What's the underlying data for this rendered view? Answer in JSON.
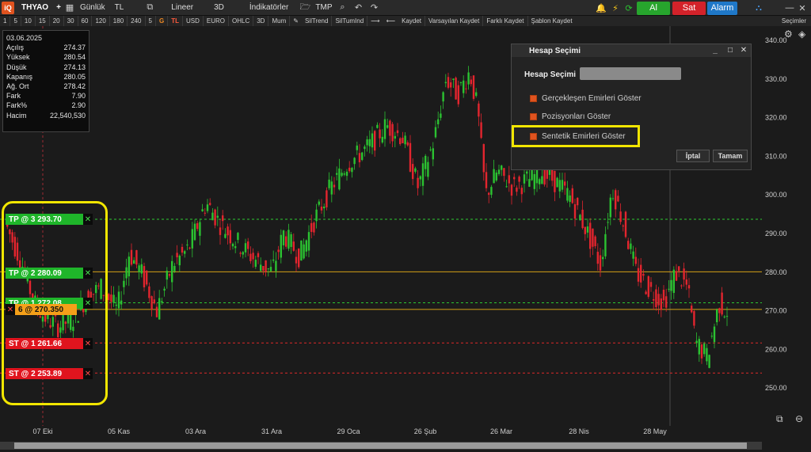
{
  "toolbar": {
    "logo": "iQ",
    "symbol": "THYAO",
    "plus": "+",
    "period": "Günlük",
    "currency": "TL",
    "scale": "Lineer",
    "view3d": "3D",
    "indicators": "İndikatörler",
    "tmp": "TMP",
    "buy": "Al",
    "sell": "Sat",
    "alarm": "Alarm"
  },
  "toolbar2": {
    "intervals": [
      "1",
      "5",
      "10",
      "15",
      "20",
      "30",
      "60",
      "120",
      "180",
      "240",
      "5"
    ],
    "g": "G",
    "tl": "TL",
    "usd": "USD",
    "euro": "EURO",
    "ohlc": "OHLC",
    "v3d": "3D",
    "mum": "Mum",
    "siltrend": "SilTrend",
    "siltumind": "SilTumInd",
    "kaydet": "Kaydet",
    "varsayilan": "Varsayılan Kaydet",
    "farkli": "Farklı Kaydet",
    "sablon": "Şablon Kaydet",
    "secimler": "Seçimler"
  },
  "info": {
    "date": "03.06.2025",
    "rows": [
      {
        "k": "Açılış",
        "v": "274.37"
      },
      {
        "k": "Yüksek",
        "v": "280.54"
      },
      {
        "k": "Düşük",
        "v": "274.13"
      },
      {
        "k": "Kapanış",
        "v": "280.05"
      },
      {
        "k": "Ağ. Ort",
        "v": "278.42"
      },
      {
        "k": "Fark",
        "v": "7.90"
      },
      {
        "k": "Fark%",
        "v": "2.90"
      },
      {
        "k": "Hacim",
        "v": "22,540,530"
      }
    ]
  },
  "orders": {
    "tp3": "TP @ 3 293.70",
    "tp2": "TP @ 2 280.09",
    "tp1": "TP @ 1 272.08",
    "position": "6 @ 270.350",
    "st1": "ST @ 1 261.66",
    "st2": "ST @ 2 253.89",
    "close_symbol": "✕"
  },
  "dialog": {
    "title": "Hesap Seçimi",
    "account_label": "Hesap Seçimi",
    "options": [
      "Gerçekleşen Emirleri Göster",
      "Pozisyonları Göster",
      "Sentetik Emirleri Göster"
    ],
    "cancel": "İptal",
    "ok": "Tamam"
  },
  "y_axis": [
    "340.00",
    "330.00",
    "320.00",
    "310.00",
    "300.00",
    "290.00",
    "280.00",
    "270.00",
    "260.00",
    "250.00"
  ],
  "x_axis": [
    "07 Eki",
    "05 Kas",
    "03 Ara",
    "31 Ara",
    "29 Oca",
    "26 Şub",
    "26 Mar",
    "28 Nis",
    "28 May"
  ],
  "colors": {
    "up": "#2bc231",
    "down": "#e3252e",
    "tp_line": "#2cc932",
    "st_line": "#e02a2a",
    "price_line": "#d4a017",
    "highlight": "#f2e600"
  }
}
